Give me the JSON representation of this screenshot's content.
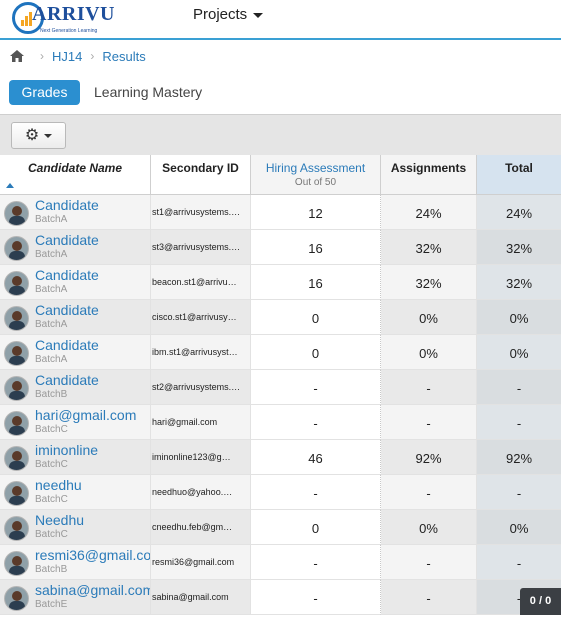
{
  "header": {
    "logo_text": "ARRIVU",
    "logo_tagline": "Next Generation Learning",
    "projects_label": "Projects"
  },
  "breadcrumb": {
    "course": "HJ14",
    "page": "Results"
  },
  "tabs": {
    "active": "Grades",
    "other": "Learning Mastery"
  },
  "toolbar": {
    "settings_icon": "gear-icon"
  },
  "columns": {
    "name": "Candidate Name",
    "secondary": "Secondary ID",
    "hiring": "Hiring Assessment",
    "hiring_sub": "Out of 50",
    "assignments": "Assignments",
    "total": "Total"
  },
  "rows": [
    {
      "name": "Candidate",
      "batch": "BatchA",
      "sec": "st1@arrivusystems.…",
      "hire": "12",
      "asg": "24%",
      "total": "24%"
    },
    {
      "name": "Candidate",
      "batch": "BatchA",
      "sec": "st3@arrivusystems.…",
      "hire": "16",
      "asg": "32%",
      "total": "32%"
    },
    {
      "name": "Candidate",
      "batch": "BatchA",
      "sec": "beacon.st1@arrivu…",
      "hire": "16",
      "asg": "32%",
      "total": "32%"
    },
    {
      "name": "Candidate",
      "batch": "BatchA",
      "sec": "cisco.st1@arrivusy…",
      "hire": "0",
      "asg": "0%",
      "total": "0%"
    },
    {
      "name": "Candidate",
      "batch": "BatchA",
      "sec": "ibm.st1@arrivusyst…",
      "hire": "0",
      "asg": "0%",
      "total": "0%"
    },
    {
      "name": "Candidate",
      "batch": "BatchB",
      "sec": "st2@arrivusystems.…",
      "hire": "-",
      "asg": "-",
      "total": "-"
    },
    {
      "name": "hari@gmail.com",
      "batch": "BatchC",
      "sec": "hari@gmail.com",
      "hire": "-",
      "asg": "-",
      "total": "-"
    },
    {
      "name": "iminonline",
      "batch": "BatchC",
      "sec": "iminonline123@g…",
      "hire": "46",
      "asg": "92%",
      "total": "92%"
    },
    {
      "name": "needhu",
      "batch": "BatchC",
      "sec": "needhuo@yahoo.…",
      "hire": "-",
      "asg": "-",
      "total": "-"
    },
    {
      "name": "Needhu",
      "batch": "BatchC",
      "sec": "cneedhu.feb@gm…",
      "hire": "0",
      "asg": "0%",
      "total": "0%"
    },
    {
      "name": "resmi36@gmail.com",
      "batch": "BatchB",
      "sec": "resmi36@gmail.com",
      "hire": "-",
      "asg": "-",
      "total": "-"
    },
    {
      "name": "sabina@gmail.com",
      "batch": "BatchE",
      "sec": "sabina@gmail.com",
      "hire": "-",
      "asg": "-",
      "total": "-"
    }
  ],
  "pager": "0 / 0"
}
